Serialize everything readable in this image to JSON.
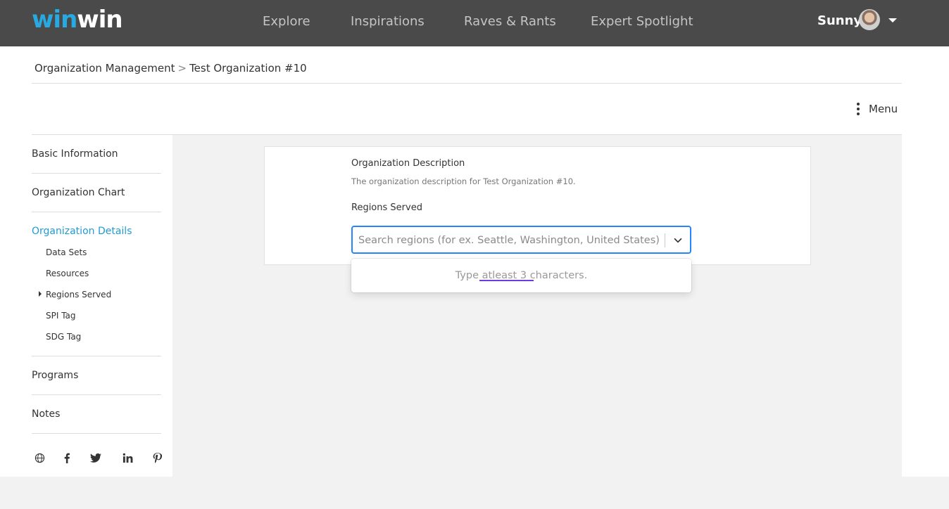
{
  "header": {
    "logo_part1": "win",
    "logo_part2": "win",
    "nav": [
      "Explore",
      "Inspirations",
      "Raves & Rants",
      "Expert Spotlight"
    ],
    "user_name": "Sunny"
  },
  "breadcrumb": {
    "parent": "Organization Management",
    "separator": ">",
    "current": "Test Organization #10"
  },
  "menu_label": "Menu",
  "sidebar": {
    "items": [
      "Basic Information",
      "Organization Chart",
      "Organization Details",
      "Programs",
      "Notes"
    ],
    "active_item": "Organization Details",
    "sub_items": [
      "Data Sets",
      "Resources",
      "Regions Served",
      "SPI Tag",
      "SDG Tag"
    ],
    "social_icons": [
      "globe-icon",
      "facebook-icon",
      "twitter-icon",
      "linkedin-icon",
      "pinterest-icon"
    ]
  },
  "form": {
    "description_label": "Organization Description",
    "description_value": "The organization description for Test Organization #10.",
    "regions_label": "Regions Served",
    "search_placeholder": "Search regions (for ex. Seattle, Washington, United States)",
    "no_options_message": "Type atleast 3 characters."
  },
  "colors": {
    "topbar": "#4a4a4a",
    "brand_blue": "#29a9e1",
    "active_link": "#1f9bd7",
    "focus_border": "#2684ff",
    "spellcheck_underline": "#6a3de0"
  }
}
